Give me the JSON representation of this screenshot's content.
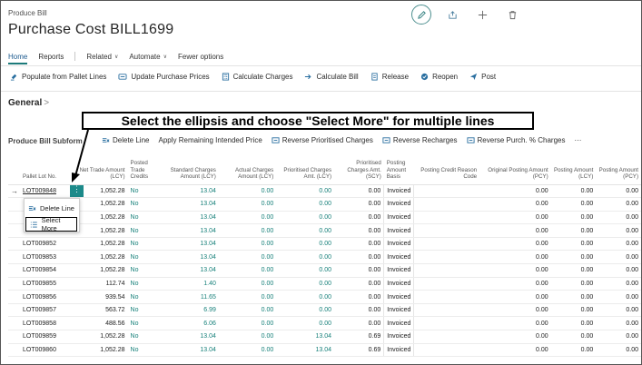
{
  "header": {
    "breadcrumb": "Produce Bill",
    "title": "Purchase Cost BILL1699"
  },
  "menu": {
    "home": "Home",
    "reports": "Reports",
    "related": "Related",
    "automate": "Automate",
    "fewer": "Fewer options"
  },
  "actions": {
    "populate": "Populate from Pallet Lines",
    "update_prices": "Update Purchase Prices",
    "calc_charges": "Calculate Charges",
    "calc_bill": "Calculate Bill",
    "release": "Release",
    "reopen": "Reopen",
    "post": "Post"
  },
  "general": "General",
  "callout": "Select the ellipsis and choose \"Select More\" for multiple lines",
  "subform": {
    "title": "Produce Bill Subform",
    "delete_line": "Delete Line",
    "apply_remaining": "Apply Remaining Intended Price",
    "reverse_prioritised": "Reverse Prioritised Charges",
    "reverse_recharges": "Reverse Recharges",
    "reverse_purch": "Reverse Purch. % Charges",
    "more": "···"
  },
  "columns": [
    "Pallet Lot No.",
    "Net Trade Amount (LCY)",
    "Posted Trade Credits",
    "Standard Charges Amount (LCY)",
    "Actual Charges Amount (LCY)",
    "Prioritised Charges Amt. (LCY)",
    "Prioritised Charges Amt. (SCY)",
    "Posting Amount Basis",
    "Posting Credit Reason Code",
    "Original Posting Amount (PCY)",
    "Posting Amount (LCY)",
    "Posting Amount (PCY)"
  ],
  "rows": [
    [
      "LOT009848",
      "1,052.28",
      "No",
      "13.04",
      "0.00",
      "0.00",
      "0.00",
      "Invoiced",
      "",
      "0.00",
      "0.00",
      "0.00"
    ],
    [
      "",
      "1,052.28",
      "No",
      "13.04",
      "0.00",
      "0.00",
      "0.00",
      "Invoiced",
      "",
      "0.00",
      "0.00",
      "0.00"
    ],
    [
      "",
      "1,052.28",
      "No",
      "13.04",
      "0.00",
      "0.00",
      "0.00",
      "Invoiced",
      "",
      "0.00",
      "0.00",
      "0.00"
    ],
    [
      "",
      "1,052.28",
      "No",
      "13.04",
      "0.00",
      "0.00",
      "0.00",
      "Invoiced",
      "",
      "0.00",
      "0.00",
      "0.00"
    ],
    [
      "LOT009852",
      "1,052.28",
      "No",
      "13.04",
      "0.00",
      "0.00",
      "0.00",
      "Invoiced",
      "",
      "0.00",
      "0.00",
      "0.00"
    ],
    [
      "LOT009853",
      "1,052.28",
      "No",
      "13.04",
      "0.00",
      "0.00",
      "0.00",
      "Invoiced",
      "",
      "0.00",
      "0.00",
      "0.00"
    ],
    [
      "LOT009854",
      "1,052.28",
      "No",
      "13.04",
      "0.00",
      "0.00",
      "0.00",
      "Invoiced",
      "",
      "0.00",
      "0.00",
      "0.00"
    ],
    [
      "LOT009855",
      "112.74",
      "No",
      "1.40",
      "0.00",
      "0.00",
      "0.00",
      "Invoiced",
      "",
      "0.00",
      "0.00",
      "0.00"
    ],
    [
      "LOT009856",
      "939.54",
      "No",
      "11.65",
      "0.00",
      "0.00",
      "0.00",
      "Invoiced",
      "",
      "0.00",
      "0.00",
      "0.00"
    ],
    [
      "LOT009857",
      "563.72",
      "No",
      "6.99",
      "0.00",
      "0.00",
      "0.00",
      "Invoiced",
      "",
      "0.00",
      "0.00",
      "0.00"
    ],
    [
      "LOT009858",
      "488.56",
      "No",
      "6.06",
      "0.00",
      "0.00",
      "0.00",
      "Invoiced",
      "",
      "0.00",
      "0.00",
      "0.00"
    ],
    [
      "LOT009859",
      "1,052.28",
      "No",
      "13.04",
      "0.00",
      "13.04",
      "0.69",
      "Invoiced",
      "",
      "0.00",
      "0.00",
      "0.00"
    ],
    [
      "LOT009860",
      "1,052.28",
      "No",
      "13.04",
      "0.00",
      "13.04",
      "0.69",
      "Invoiced",
      "",
      "0.00",
      "0.00",
      "0.00"
    ]
  ],
  "context_menu": {
    "delete_line": "Delete Line",
    "select_more": "Select More"
  },
  "ellipsis": "⋮",
  "row_arrow": "→",
  "colors": {
    "accent": "#1c8a8a",
    "link": "#17807a",
    "brand_blue": "#1c5a8f"
  }
}
